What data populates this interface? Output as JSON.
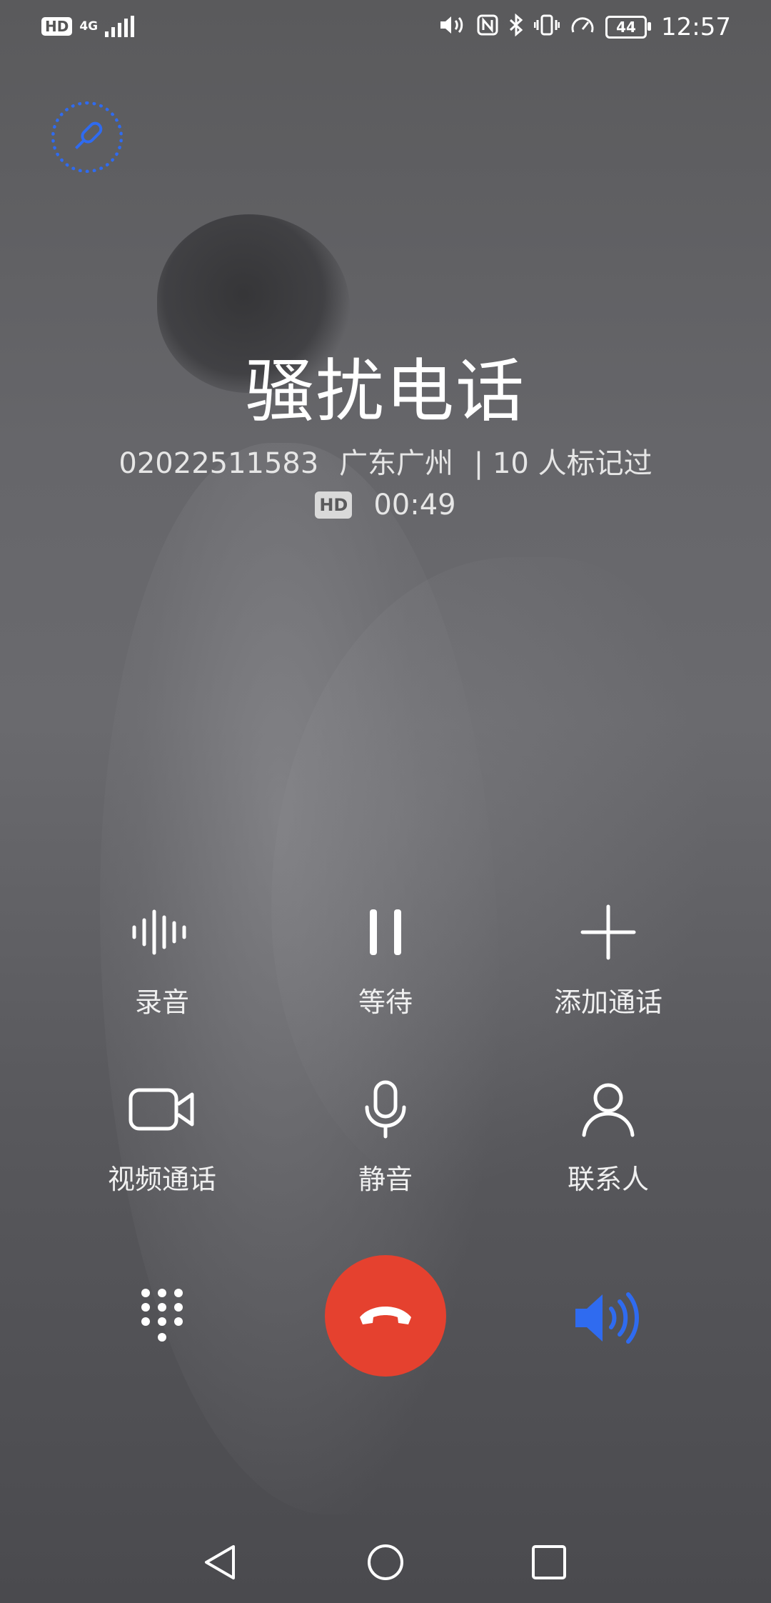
{
  "status_bar": {
    "hd": "HD",
    "network": "4G",
    "time": "12:57",
    "battery": "44"
  },
  "caller": {
    "name": "骚扰电话",
    "number": "02022511583",
    "location": "广东广州",
    "marked": "| 10 人标记过"
  },
  "call": {
    "hd_badge": "HD",
    "duration": "00:49"
  },
  "actions": {
    "record": "录音",
    "hold": "等待",
    "add_call": "添加通话",
    "video_call": "视频通话",
    "mute": "静音",
    "contacts": "联系人"
  },
  "colors": {
    "end_call": "#e5412f",
    "accent_blue": "#2f6bf0"
  },
  "icons": {
    "voice": "voice-assistant-icon",
    "record": "waveform-icon",
    "hold": "pause-icon",
    "add_call": "plus-icon",
    "video_call": "video-camera-icon",
    "mute": "microphone-icon",
    "contacts": "person-icon",
    "dialpad": "dialpad-icon",
    "end_call": "end-call-icon",
    "speaker": "speaker-icon",
    "nav_back": "back-triangle-icon",
    "nav_home": "home-circle-icon",
    "nav_recent": "recent-square-icon"
  }
}
